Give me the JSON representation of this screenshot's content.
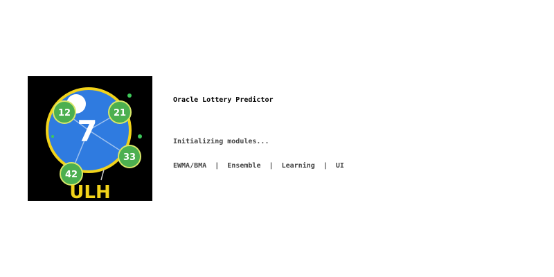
{
  "splash": {
    "title": "Oracle Lottery Predictor",
    "status": "Initializing modules...",
    "modules": [
      "EWMA/BMA",
      "Ensemble",
      "Learning",
      "UI"
    ],
    "separator": "|"
  },
  "logo": {
    "icon": "lottery-ball-logo-icon",
    "center_number": "7",
    "balls": [
      "12",
      "21",
      "33",
      "42"
    ],
    "wordmark": "ULH",
    "colors": {
      "background": "#000000",
      "globe": "#2f7be0",
      "ring": "#f2d31a",
      "ball": "#4caf50",
      "wordmark": "#f2d31a"
    }
  }
}
